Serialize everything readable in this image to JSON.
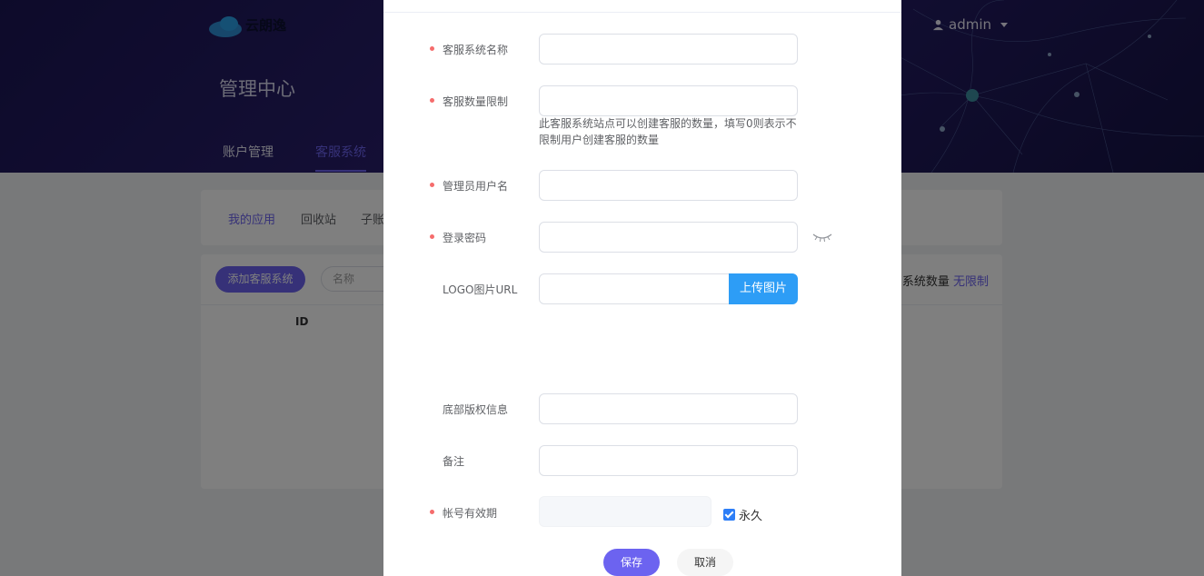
{
  "header": {
    "logo_text": "云朗逸",
    "page_title": "管理中心",
    "nav": [
      {
        "label": "账户管理",
        "active": false
      },
      {
        "label": "客服系统",
        "active": true
      }
    ],
    "user": "admin"
  },
  "tabs": [
    "我的应用",
    "回收站",
    "子账"
  ],
  "list": {
    "add_button": "添加客服系统",
    "search_placeholder": "名称",
    "quota_label": "系统数量",
    "quota_value": "无限制",
    "col_id": "ID"
  },
  "form": {
    "name_label": "客服系统名称",
    "limit_label": "客服数量限制",
    "limit_hint": "此客服系统站点可以创建客服的数量，填写0则表示不限制用户创建客服的数量",
    "admin_label": "管理员用户名",
    "password_label": "登录密码",
    "logo_label": "LOGO图片URL",
    "upload_label": "上传图片",
    "copyright_label": "底部版权信息",
    "remark_label": "备注",
    "expire_label": "帐号有效期",
    "permanent_label": "永久",
    "permanent_checked": true,
    "save_label": "保存",
    "cancel_label": "取消"
  },
  "colors": {
    "accent": "#6c63f0",
    "upload": "#2d9df6",
    "required": "#f56c6c"
  }
}
